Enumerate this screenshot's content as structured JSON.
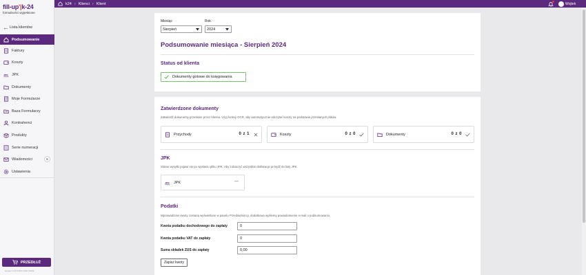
{
  "brand": {
    "logo_left": "fill-up",
    "logo_bar": "'|",
    "logo_right": "k-24",
    "logo_sub": "formalności wypełnione",
    "accent": "#5b2a7e"
  },
  "sidebar": {
    "back_label": "Lista klientów",
    "items": [
      {
        "label": "Podsumowanie",
        "icon": "home-icon",
        "active": true
      },
      {
        "label": "Faktury",
        "icon": "invoice-icon"
      },
      {
        "label": "Koszty",
        "icon": "wallet-icon"
      },
      {
        "label": "JPK",
        "icon": "jpk-icon"
      },
      {
        "label": "Dokumenty",
        "icon": "folder-icon"
      },
      {
        "label": "Moje Formularze",
        "icon": "form-icon"
      },
      {
        "label": "Baza Formularzy",
        "icon": "form-base-icon"
      },
      {
        "label": "Kontrahenci",
        "icon": "person-icon"
      },
      {
        "label": "Produkty",
        "icon": "box-icon"
      },
      {
        "label": "Serie numeracji",
        "icon": "list-icon"
      },
      {
        "label": "Wiadomości",
        "icon": "mail-icon",
        "badge": "6"
      },
      {
        "label": "Ustawienia",
        "icon": "gear-icon"
      }
    ],
    "extend_label": "PRZEDŁUŻ",
    "version": "wersja 1.4.0.8.18.0.2019 (7320)"
  },
  "topbar": {
    "crumbs": [
      "k24",
      "Klienci",
      "Klient"
    ],
    "user_name": "Wojtek"
  },
  "summary": {
    "month_label": "Miesiąc",
    "month_value": "Sierpień",
    "year_label": "Rok",
    "year_value": "2024",
    "title": "Podsumowanie miesiąca - Sierpień 2024",
    "status_heading": "Status od klienta",
    "status_value": "Dokumenty gotowe do księgowania"
  },
  "approved": {
    "heading": "Zatwierdzone dokumenty",
    "description": "Zatwierdź dokumenty przesłane przez klienta. Użyj funkcji OCR, aby automatycznie odczytać koszty na podstawie przesłanych plików.",
    "boxes": [
      {
        "label": "Przychody",
        "count": "0 z 1",
        "action": "✕"
      },
      {
        "label": "Koszty",
        "count": "0 z 0",
        "action": "✓"
      },
      {
        "label": "Dokumenty",
        "count": "0 z 0",
        "action": "✓"
      }
    ]
  },
  "jpk": {
    "heading": "JPK",
    "description": "Status wysyłki pojawi się po wysłaniu pliku JPK. Aby zobaczyć wszystkie deklaracje przejdź do listy JPK.",
    "box_label": "JPK",
    "box_status": "—"
  },
  "taxes": {
    "heading": "Podatki",
    "description": "Wprowadzone kwoty zostaną wyświetlone w panelu Przedsiębiorcy, dodatkowo wyślemy powiadomienie e-mail o podsumowaniu.",
    "fields": [
      {
        "label": "Kwota podatku dochodowego do zapłaty",
        "value": "0"
      },
      {
        "label": "Kwota podatku VAT do zapłaty",
        "value": "0"
      },
      {
        "label": "Suma składek ZUS do zapłaty",
        "value": "0,00"
      }
    ],
    "save_label": "Zapisz kwoty"
  }
}
